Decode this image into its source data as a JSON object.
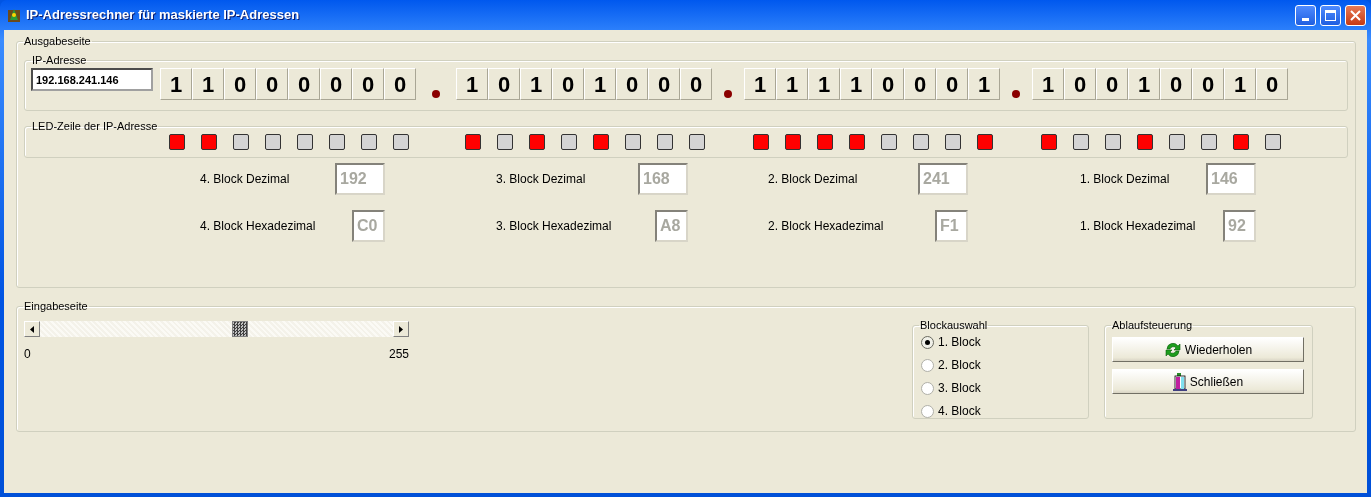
{
  "window": {
    "title": "IP-Adressrechner für maskierte IP-Adressen"
  },
  "output_section": {
    "title": "Ausgabeseite",
    "ip_group": {
      "title": "IP-Adresse",
      "value": "192.168.241.146",
      "bytes": [
        {
          "bits": [
            "1",
            "1",
            "0",
            "0",
            "0",
            "0",
            "0",
            "0"
          ]
        },
        {
          "bits": [
            "1",
            "0",
            "1",
            "0",
            "1",
            "0",
            "0",
            "0"
          ]
        },
        {
          "bits": [
            "1",
            "1",
            "1",
            "1",
            "0",
            "0",
            "0",
            "1"
          ]
        },
        {
          "bits": [
            "1",
            "0",
            "0",
            "1",
            "0",
            "0",
            "1",
            "0"
          ]
        }
      ]
    },
    "led_group": {
      "title": "LED-Zeile der IP-Adresse",
      "bytes": [
        {
          "leds": [
            {
              "on": true
            },
            {
              "on": true
            },
            {
              "on": false
            },
            {
              "on": false
            },
            {
              "on": false
            },
            {
              "on": false
            },
            {
              "on": false
            },
            {
              "on": false
            }
          ]
        },
        {
          "leds": [
            {
              "on": true
            },
            {
              "on": false
            },
            {
              "on": true
            },
            {
              "on": false
            },
            {
              "on": true
            },
            {
              "on": false
            },
            {
              "on": false
            },
            {
              "on": false
            }
          ]
        },
        {
          "leds": [
            {
              "on": true
            },
            {
              "on": true
            },
            {
              "on": true
            },
            {
              "on": true
            },
            {
              "on": false
            },
            {
              "on": false
            },
            {
              "on": false
            },
            {
              "on": true
            }
          ]
        },
        {
          "leds": [
            {
              "on": true
            },
            {
              "on": false
            },
            {
              "on": false
            },
            {
              "on": true
            },
            {
              "on": false
            },
            {
              "on": false
            },
            {
              "on": true
            },
            {
              "on": false
            }
          ]
        }
      ]
    },
    "decimal": [
      {
        "label": "4. Block Dezimal",
        "value": "192",
        "disabled": true
      },
      {
        "label": "3. Block Dezimal",
        "value": "168",
        "disabled": true
      },
      {
        "label": "2. Block Dezimal",
        "value": "241",
        "disabled": true
      },
      {
        "label": "1. Block Dezimal",
        "value": "146",
        "disabled": true
      }
    ],
    "hex": [
      {
        "label": "4. Block Hexadezimal",
        "value": "C0",
        "disabled": true
      },
      {
        "label": "3. Block Hexadezimal",
        "value": "A8",
        "disabled": true
      },
      {
        "label": "2. Block Hexadezimal",
        "value": "F1",
        "disabled": true
      },
      {
        "label": "1. Block Hexadezimal",
        "value": "92",
        "disabled": true
      }
    ]
  },
  "input_section": {
    "title": "Eingabeseite",
    "slider": {
      "level": 0.57,
      "min_label": "0",
      "max_label": "255"
    },
    "block_selection": {
      "title": "Blockauswahl",
      "options": [
        {
          "label": "1. Block",
          "selected": true
        },
        {
          "label": "2. Block",
          "selected": false
        },
        {
          "label": "3. Block",
          "selected": false
        },
        {
          "label": "4. Block",
          "selected": false
        }
      ]
    },
    "control": {
      "title": "Ablaufsteuerung",
      "buttons": [
        {
          "label": "Wiederholen",
          "kind": "repeat"
        },
        {
          "label": "Schließen",
          "kind": "close"
        }
      ]
    }
  }
}
